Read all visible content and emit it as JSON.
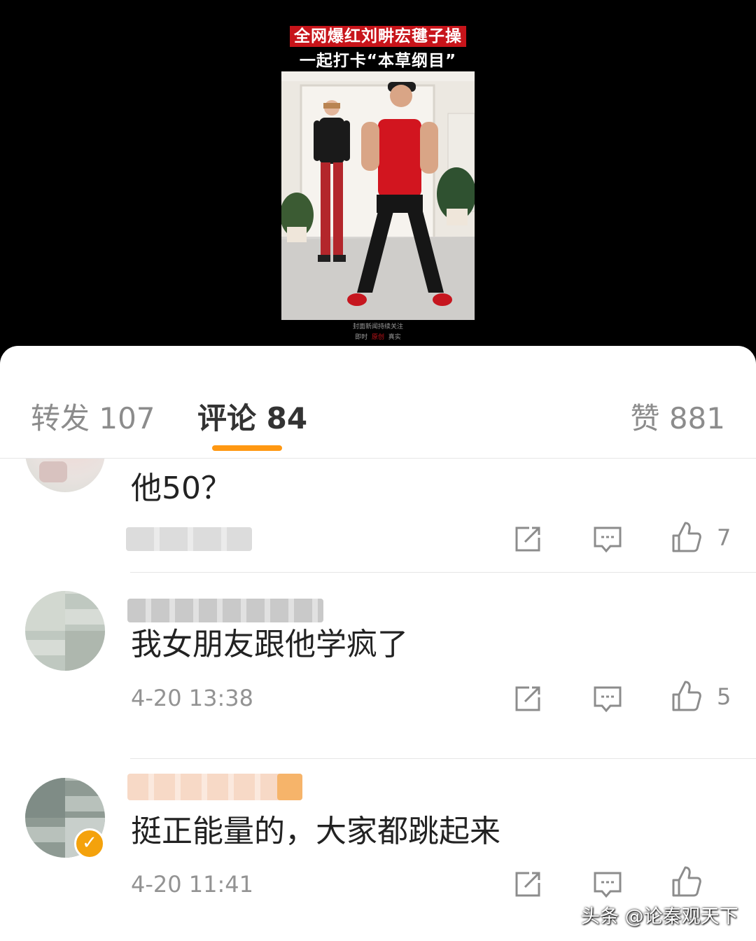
{
  "video": {
    "caption_line1": "全网爆红刘畊宏毽子操",
    "caption_line2": "一起打卡“本草纲目”",
    "watermark_line1": "封面新闻持续关注",
    "watermark_line2_a": "即时",
    "watermark_line2_b": "原创",
    "watermark_line2_c": "真实"
  },
  "tabs": {
    "forward": "转发 107",
    "comments": "评论 84",
    "likes": "赞 881"
  },
  "comments": [
    {
      "text": "他50？",
      "time": "",
      "like_count": "7"
    },
    {
      "text": "我女朋友跟他学疯了",
      "time": "4-20 13:38",
      "like_count": "5"
    },
    {
      "text": "挺正能量的，大家都跳起来",
      "time": "4-20 11:41",
      "like_count": ""
    }
  ],
  "footer_watermark": "头条 @论秦观天下",
  "colors": {
    "accent": "#ff9812",
    "caption_red": "#c7141a",
    "verified": "#f4a20c"
  }
}
